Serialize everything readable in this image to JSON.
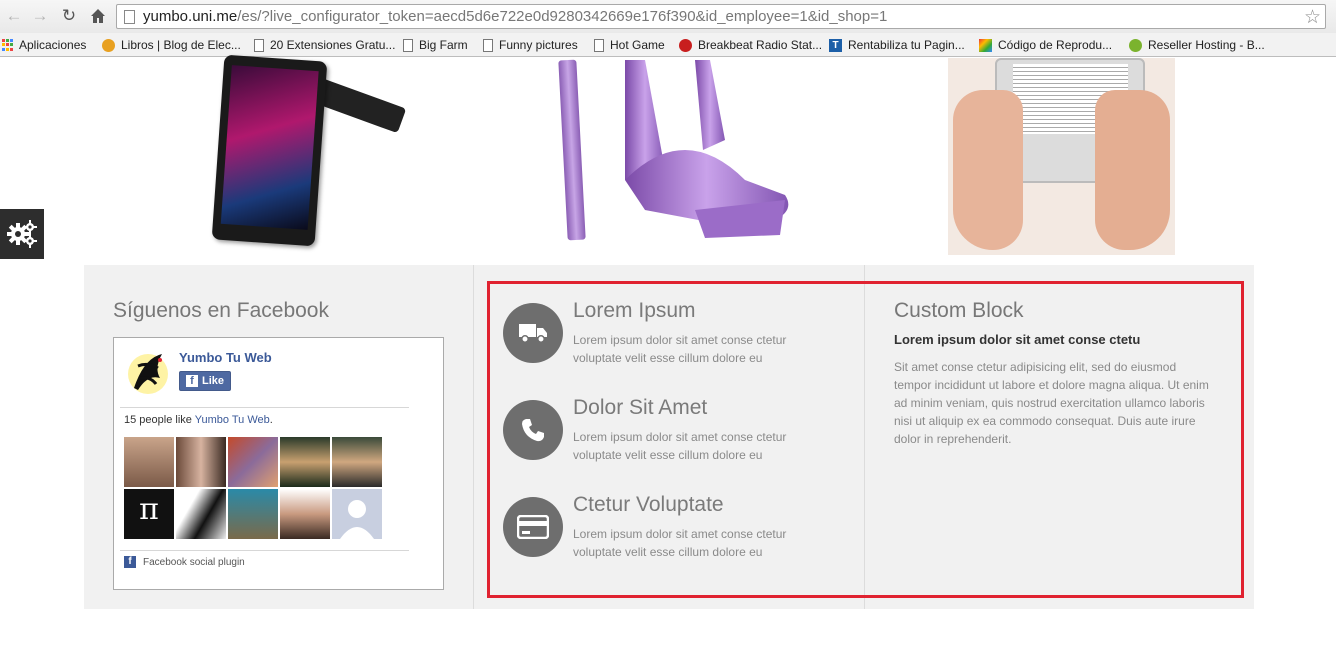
{
  "browser": {
    "url_host": "yumbo.uni.me",
    "url_path": "/es/?live_configurator_token=aecd5d6e722e0d9280342669e176f390&id_employee=1&id_shop=1",
    "bookmarks": [
      {
        "label": "Aplicaciones",
        "icon": "apps-grid-icon"
      },
      {
        "label": "Libros | Blog de Elec...",
        "icon": "shield-icon"
      },
      {
        "label": "20 Extensiones Gratu...",
        "icon": "page-icon"
      },
      {
        "label": "Big Farm",
        "icon": "page-icon"
      },
      {
        "label": "Funny pictures",
        "icon": "page-icon"
      },
      {
        "label": "Hot Game",
        "icon": "page-icon"
      },
      {
        "label": "Breakbeat Radio Stat...",
        "icon": "radio-icon"
      },
      {
        "label": "Rentabiliza tu Pagin...",
        "icon": "t-logo-icon"
      },
      {
        "label": "Código de Reprodu...",
        "icon": "youtube-icon"
      },
      {
        "label": "Reseller Hosting - B...",
        "icon": "hosting-icon"
      }
    ]
  },
  "facebook": {
    "section_title": "Síguenos en Facebook",
    "page_name": "Yumbo Tu Web",
    "like_label": "Like",
    "like_count_prefix": "15 people like ",
    "like_count_link": "Yumbo Tu Web",
    "like_count_suffix": ".",
    "plugin_label": "Facebook social plugin",
    "faces_count": 10
  },
  "features": [
    {
      "title": "Lorem Ipsum",
      "text": "Lorem ipsum dolor sit amet conse ctetur voluptate velit esse cillum dolore eu",
      "icon": "truck-icon"
    },
    {
      "title": "Dolor Sit Amet",
      "text": "Lorem ipsum dolor sit amet conse ctetur voluptate velit esse cillum dolore eu",
      "icon": "phone-icon"
    },
    {
      "title": "Ctetur Voluptate",
      "text": "Lorem ipsum dolor sit amet conse ctetur voluptate velit esse cillum dolore eu",
      "icon": "credit-card-icon"
    }
  ],
  "custom_block": {
    "title": "Custom Block",
    "subtitle": "Lorem ipsum dolor sit amet conse ctetu",
    "text": "Sit amet conse ctetur adipisicing elit, sed do eiusmod tempor incididunt ut labore et dolore magna aliqua. Ut enim ad minim veniam, quis nostrud exercitation ullamco laboris nisi ut aliquip ex ea commodo consequat. Duis aute irure dolor in reprehenderit."
  },
  "colors": {
    "highlight_border": "#e02230",
    "facebook_blue": "#3b5998",
    "feature_icon_bg": "#6e6e6e"
  }
}
